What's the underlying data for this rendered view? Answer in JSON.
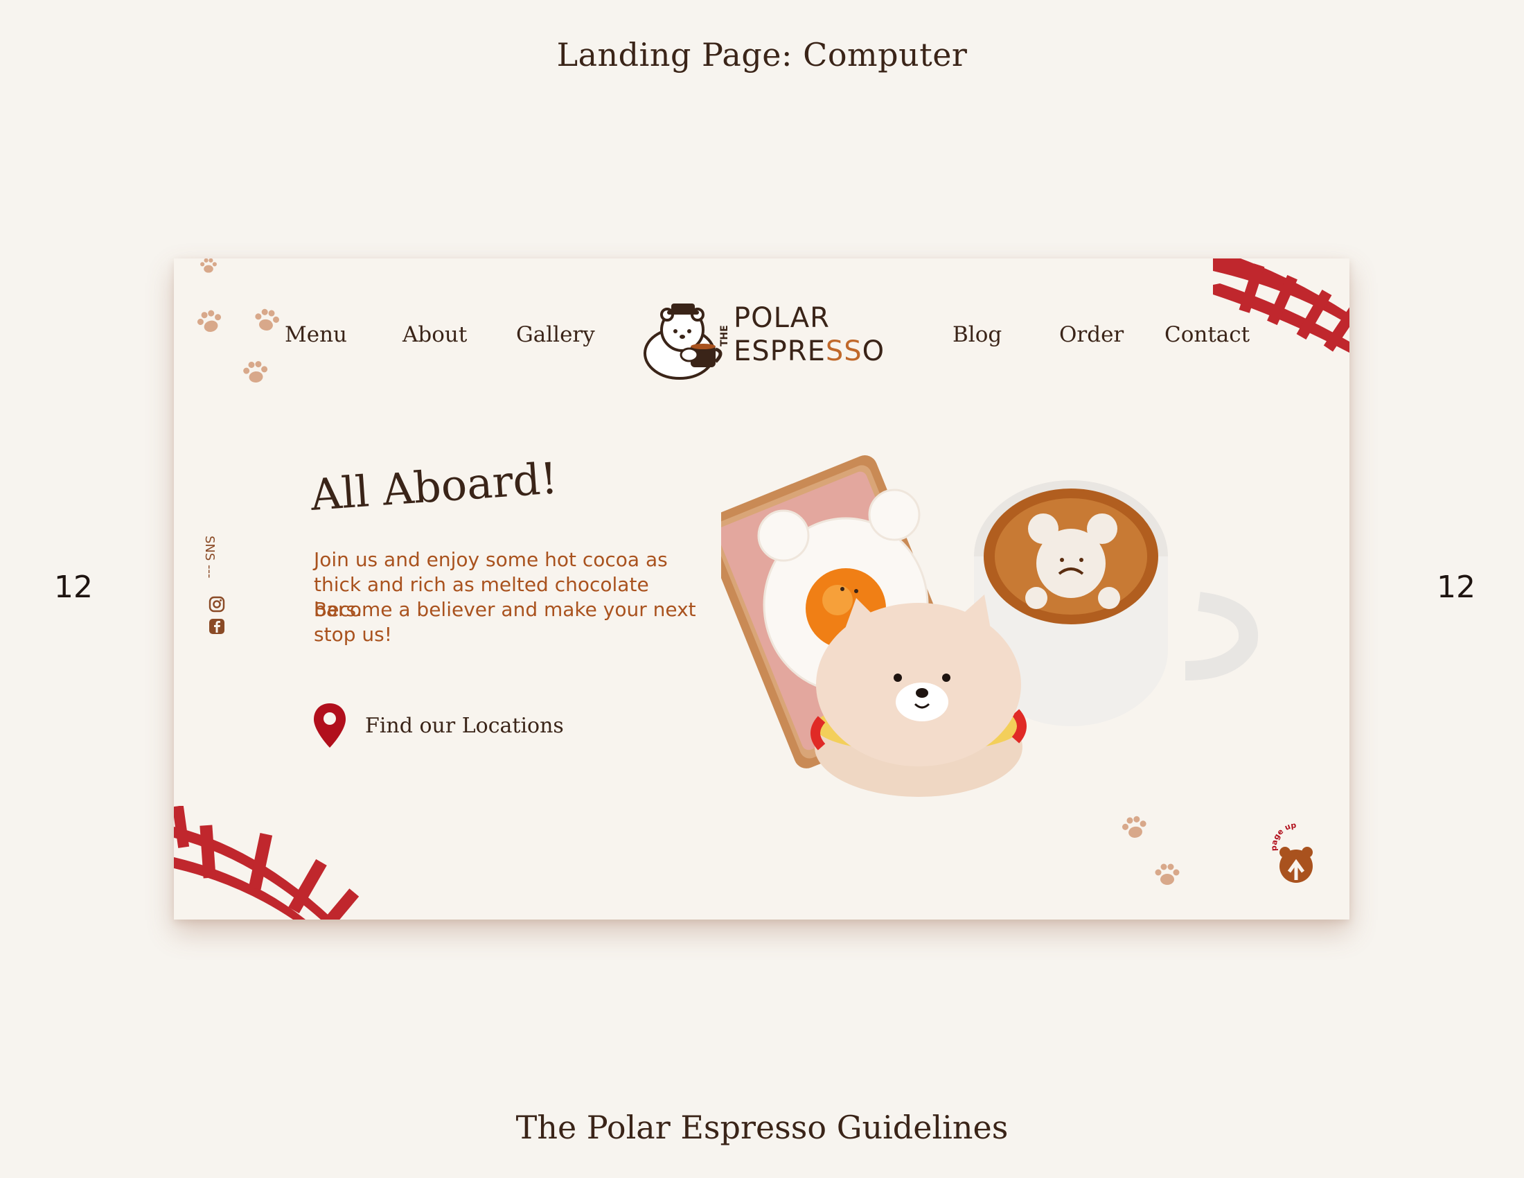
{
  "page": {
    "heading": "Landing Page: Computer",
    "footer": "The Polar Espresso Guidelines",
    "page_number_left": "12",
    "page_number_right": "12"
  },
  "nav": {
    "left": [
      "Menu",
      "About",
      "Gallery"
    ],
    "right": [
      "Blog",
      "Order",
      "Contact"
    ]
  },
  "logo": {
    "the": "THE",
    "line1": "POLAR",
    "line2_main": "ESPRE",
    "line2_accent": "SS",
    "line2_end": "O"
  },
  "hero": {
    "title": "All Aboard!",
    "paragraph1": "Join us and enjoy some hot cocoa as thick and rich as melted chocolate bars.",
    "paragraph2": "Become a believer and make your next stop us!",
    "cta": "Find our Locations"
  },
  "sns": {
    "label": "SNS ---",
    "icons": [
      "instagram-icon",
      "facebook-icon"
    ]
  },
  "page_up": {
    "label": "page up"
  },
  "colors": {
    "background": "#f7f4ef",
    "frame": "#f8f4ee",
    "text_dark": "#3a2418",
    "accent_orange": "#a9521e",
    "track_red": "#c0272d",
    "paw": "#d8a88a",
    "pin_red": "#b10f1c"
  }
}
